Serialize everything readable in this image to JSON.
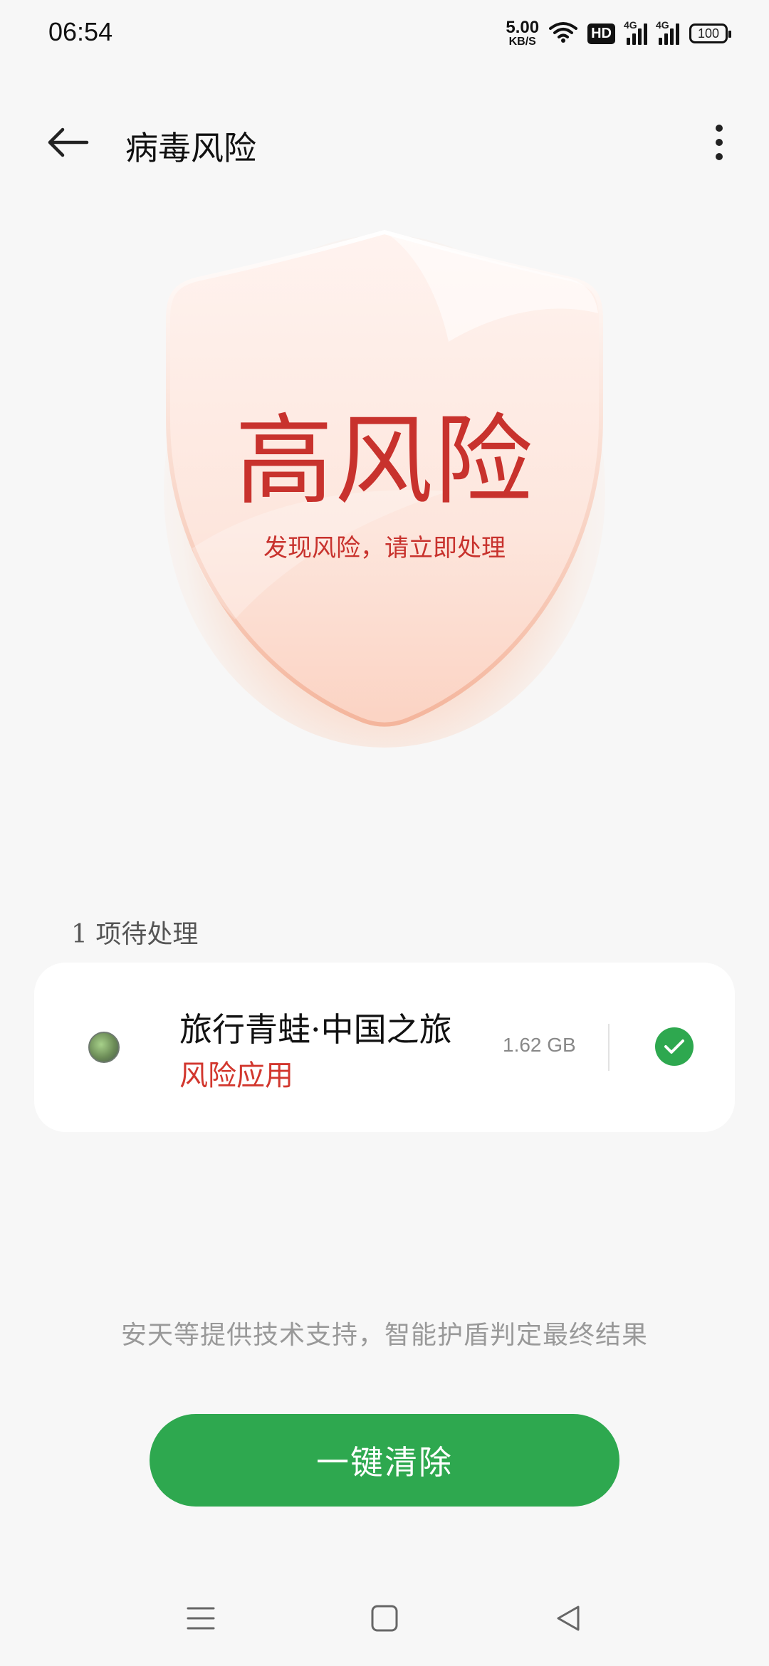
{
  "status_bar": {
    "time": "06:54",
    "net_speed_value": "5.00",
    "net_speed_unit": "KB/S",
    "hd_label": "HD",
    "sig1_label": "4G",
    "sig2_label": "4G",
    "battery": "100"
  },
  "header": {
    "title": "病毒风险"
  },
  "shield": {
    "title": "高风险",
    "subtitle": "发现风险，请立即处理",
    "colors": {
      "text": "#c8322d",
      "glow": "#ff7a3c"
    }
  },
  "pending": {
    "label": "1 项待处理"
  },
  "item": {
    "name": "旅行青蛙·中国之旅",
    "tag": "风险应用",
    "size": "1.62 GB",
    "checked": true
  },
  "footer": {
    "note": "安天等提供技术支持，智能护盾判定最终结果"
  },
  "actions": {
    "clean_label": "一键清除"
  },
  "colors": {
    "accent": "#2ea84f",
    "risk": "#d2372e"
  }
}
